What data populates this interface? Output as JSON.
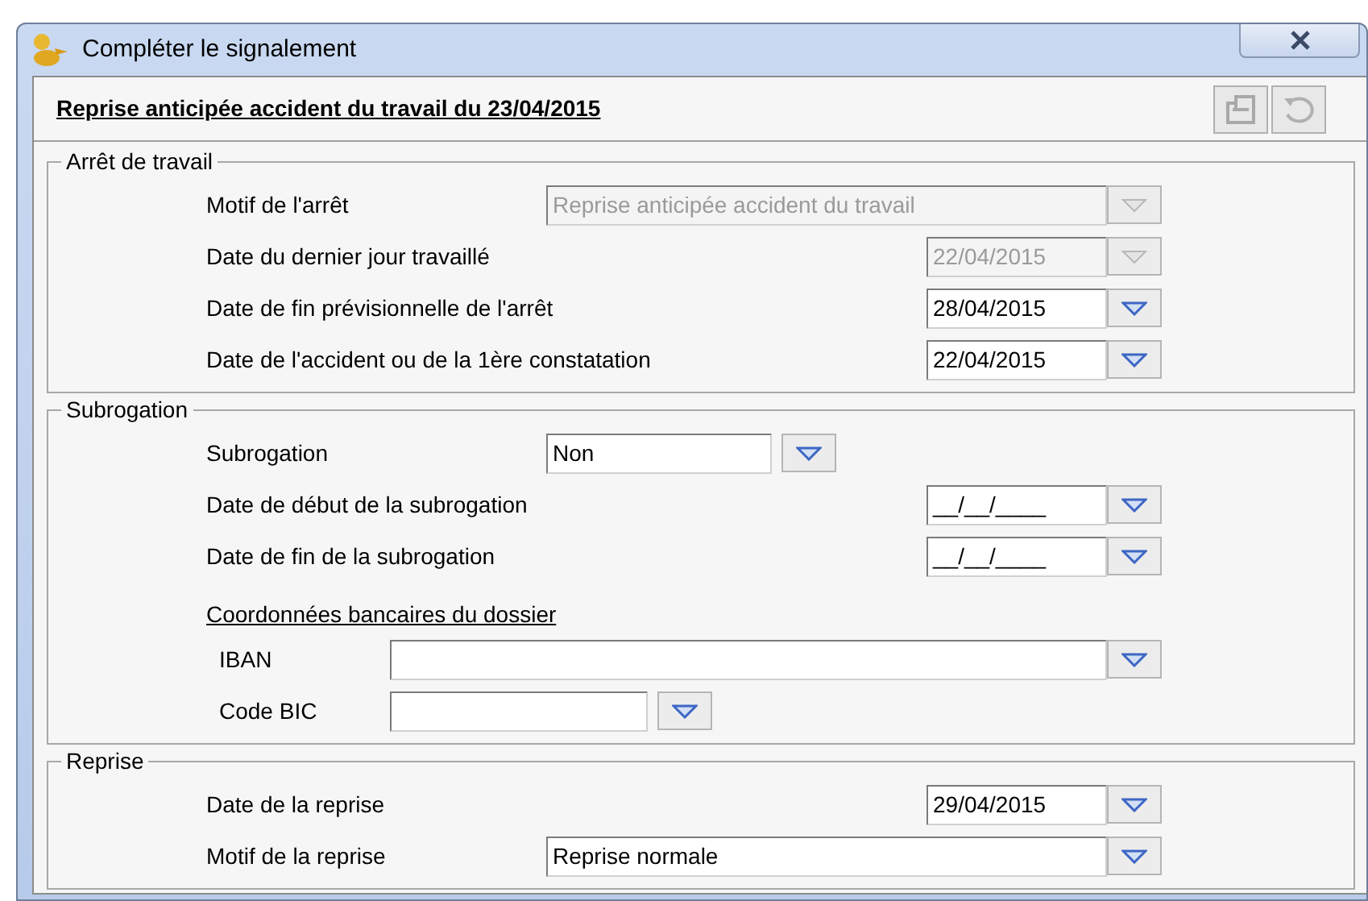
{
  "window": {
    "title": "Compléter le signalement"
  },
  "header": {
    "title": "Reprise anticipée accident du travail du 23/04/2015"
  },
  "sections": [
    {
      "legend": "Arrêt de travail",
      "rows": [
        {
          "kind": "wide",
          "label": "Motif de l'arrêt",
          "value": "Reprise anticipée accident du travail",
          "disabled": true
        },
        {
          "kind": "date",
          "label": "Date du dernier jour travaillé",
          "value": "22/04/2015",
          "disabled": true
        },
        {
          "kind": "date",
          "label": "Date de fin prévisionnelle de l'arrêt",
          "value": "28/04/2015",
          "disabled": false
        },
        {
          "kind": "date",
          "label": "Date de l'accident ou de la 1ère constatation",
          "value": "22/04/2015",
          "disabled": false
        }
      ]
    },
    {
      "legend": "Subrogation",
      "rows": [
        {
          "kind": "combo",
          "label": "Subrogation",
          "value": "Non",
          "disabled": false
        },
        {
          "kind": "date",
          "label": "Date de début de la subrogation",
          "value": "__/__/____",
          "disabled": false
        },
        {
          "kind": "date",
          "label": "Date de fin de la subrogation",
          "value": "__/__/____",
          "disabled": false
        },
        {
          "kind": "heading",
          "label": "Coordonnées bancaires du dossier"
        },
        {
          "kind": "iban",
          "label": "IBAN"
        },
        {
          "kind": "bic",
          "label": "Code BIC"
        }
      ]
    },
    {
      "legend": "Reprise",
      "rows": [
        {
          "kind": "date",
          "label": "Date de la reprise",
          "value": "29/04/2015",
          "disabled": false
        },
        {
          "kind": "wide",
          "label": "Motif de la reprise",
          "value": "Reprise normale",
          "disabled": false
        }
      ]
    }
  ]
}
